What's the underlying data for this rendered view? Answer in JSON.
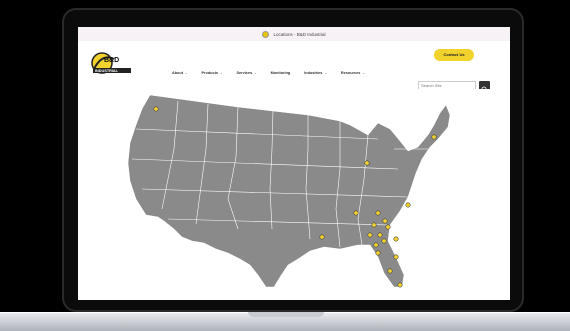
{
  "browser": {
    "tab_title": "Locations - B&D Industrial"
  },
  "brand": {
    "logo_text_top": "B&D",
    "logo_text_bottom": "INDUSTRIAL",
    "accent": "#f2d22c"
  },
  "nav": {
    "items": [
      {
        "label": "About",
        "chevron": true
      },
      {
        "label": "Products",
        "chevron": true
      },
      {
        "label": "Services",
        "chevron": true
      },
      {
        "label": "Monitoring",
        "chevron": false
      },
      {
        "label": "Industries",
        "chevron": true
      },
      {
        "label": "Resources",
        "chevron": true
      }
    ]
  },
  "header": {
    "contact_label": "Contact Us",
    "search_placeholder": "Search Site"
  },
  "map": {
    "land_color": "#8a8a8a",
    "border_color": "#ffffff",
    "marker_count": 22
  }
}
